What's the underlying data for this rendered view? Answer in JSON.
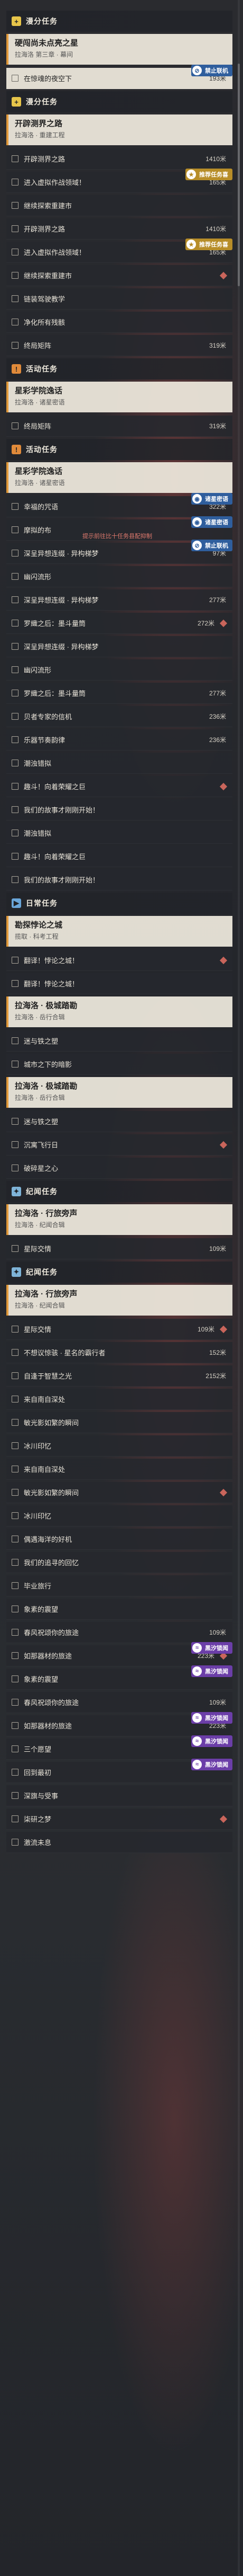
{
  "colors": {
    "side_task": "#e7c54a",
    "activity_task": "#e08a3a",
    "world_task": "#6aa6d9",
    "companion_task": "#7fb4d8",
    "accent_bar": "#e29a3b"
  },
  "rows": [
    {
      "kind": "header",
      "text": "漫分任务",
      "icon": "+",
      "color": "#e7c54a"
    },
    {
      "kind": "title",
      "title": "硬闯尚未点亮之星",
      "sub": "拉海洛 第三章 · 幕间",
      "icon": "quest-icon"
    },
    {
      "kind": "item",
      "text": "在惊魂的夜空下",
      "dist": "193米",
      "hl": true
    },
    {
      "kind": "header",
      "text": "漫分任务",
      "icon": "+",
      "color": "#e7c54a"
    },
    {
      "kind": "title",
      "title": "开辟测界之路",
      "sub": "拉海洛 · 重建工程",
      "icon": "quest-icon"
    },
    {
      "kind": "item",
      "text": "开辟测界之路",
      "dist": "1410米"
    },
    {
      "kind": "item",
      "text": "进入虚拟作战领域！",
      "dist": "165米"
    },
    {
      "kind": "item",
      "text": "继续探索重建市"
    },
    {
      "kind": "item",
      "text": "开辟测界之路",
      "dist": "1410米"
    },
    {
      "kind": "item",
      "text": "进入虚拟作战领域！",
      "dist": "165米"
    },
    {
      "kind": "item",
      "text": "继续探索重建市"
    },
    {
      "kind": "item",
      "text": "链装驾驶教学"
    },
    {
      "kind": "item",
      "text": "净化所有残骸"
    },
    {
      "kind": "item",
      "text": "终局矩阵",
      "dist": "319米"
    },
    {
      "kind": "header",
      "text": "活动任务",
      "icon": "!",
      "color": "#e08a3a"
    },
    {
      "kind": "title",
      "title": "星彩学院逸话",
      "sub": "拉海洛 · 诸星密语",
      "icon": "quest-icon"
    },
    {
      "kind": "item",
      "text": "终局矩阵",
      "dist": "319米"
    },
    {
      "kind": "header",
      "text": "活动任务",
      "icon": "!",
      "color": "#e08a3a"
    },
    {
      "kind": "title",
      "title": "星彩学院逸话",
      "sub": "拉海洛 · 诸星密语",
      "icon": "quest-icon"
    },
    {
      "kind": "item",
      "text": "幸福的咒语",
      "dist": "322米"
    },
    {
      "kind": "item",
      "text": "摩拟的布",
      "dist": ""
    },
    {
      "kind": "item",
      "text": "深呈异想连缀 · 异构梯梦",
      "dist": "97米"
    },
    {
      "kind": "item",
      "text": "幽闪流形"
    },
    {
      "kind": "item",
      "text": "深呈异想连缀 · 异构梯梦",
      "dist": "277米"
    },
    {
      "kind": "item",
      "text": "罗織之后：墨斗量筒",
      "dist": "272米"
    },
    {
      "kind": "item",
      "text": "深呈异想连缀 · 异构梯梦"
    },
    {
      "kind": "item",
      "text": "幽闪流形"
    },
    {
      "kind": "item",
      "text": "罗織之后：墨斗量筒",
      "dist": "277米"
    },
    {
      "kind": "item",
      "text": "贝者专家的信机",
      "dist": "236米"
    },
    {
      "kind": "item",
      "text": "乐器节奏韵律",
      "dist": "236米"
    },
    {
      "kind": "item",
      "text": "潮浊错拟"
    },
    {
      "kind": "item",
      "text": "趣斗！向着荣耀之巨"
    },
    {
      "kind": "item",
      "text": "我们的故事才刚刚开始！"
    },
    {
      "kind": "item",
      "text": "潮浊错拟"
    },
    {
      "kind": "item",
      "text": "趣斗！向着荣耀之巨"
    },
    {
      "kind": "item",
      "text": "我们的故事才刚刚开始！"
    },
    {
      "kind": "header",
      "text": "日常任务",
      "icon": "▶",
      "color": "#6aa6d9"
    },
    {
      "kind": "title",
      "title": "勘探悖论之城",
      "sub": "揽取 · 科考工程",
      "icon": "quest-icon"
    },
    {
      "kind": "item",
      "text": "翻译！悖论之城！"
    },
    {
      "kind": "item",
      "text": "翻译！悖论之城！"
    },
    {
      "kind": "title",
      "title": "拉海洛 · 极城踏勘",
      "sub": "拉海洛 · 岳行合辑",
      "icon": "quest-icon"
    },
    {
      "kind": "item",
      "text": "迷与铁之塑"
    },
    {
      "kind": "item",
      "text": "城市之下的暗影"
    },
    {
      "kind": "title",
      "title": "拉海洛 · 极城踏勘",
      "sub": "拉海洛 · 岳行合辑",
      "icon": "quest-icon"
    },
    {
      "kind": "item",
      "text": "迷与铁之塑"
    },
    {
      "kind": "item",
      "text": "沉寓飞行日"
    },
    {
      "kind": "item",
      "text": "破碎星之心"
    },
    {
      "kind": "header",
      "text": "纪闻任务",
      "icon": "✦",
      "color": "#7fb4d8"
    },
    {
      "kind": "title",
      "title": "拉海洛 · 行旅旁声",
      "sub": "拉海洛 · 纪闻合辑",
      "icon": "quest-icon"
    },
    {
      "kind": "item",
      "text": "星际交情",
      "dist": "109米"
    },
    {
      "kind": "header",
      "text": "纪闻任务",
      "icon": "✦",
      "color": "#7fb4d8"
    },
    {
      "kind": "title",
      "title": "拉海洛 · 行旅旁声",
      "sub": "拉海洛 · 纪闻合辑",
      "icon": "quest-icon"
    },
    {
      "kind": "item",
      "text": "星际交情",
      "dist": "109米"
    },
    {
      "kind": "item",
      "text": "不想议惊骇 · 星名的霸行者",
      "dist": "152米"
    },
    {
      "kind": "item",
      "text": "自逢于智慧之光",
      "dist": "2152米"
    },
    {
      "kind": "item",
      "text": "来自南自深处"
    },
    {
      "kind": "item",
      "text": "敏光影如繁的瞬间"
    },
    {
      "kind": "item",
      "text": "冰川印忆"
    },
    {
      "kind": "item",
      "text": "来自南自深处"
    },
    {
      "kind": "item",
      "text": "敏光影如繁的瞬间"
    },
    {
      "kind": "item",
      "text": "冰川印忆"
    },
    {
      "kind": "item",
      "text": "偶遇海洋的好机"
    },
    {
      "kind": "item",
      "text": "我们的追寻的回忆"
    },
    {
      "kind": "item",
      "text": "毕业旅行"
    },
    {
      "kind": "item",
      "text": "象素的震望"
    },
    {
      "kind": "item",
      "text": "春风祝颂你的旅途",
      "dist": "109米"
    },
    {
      "kind": "item",
      "text": "如那器材的旅途",
      "dist": "223米"
    },
    {
      "kind": "item",
      "text": "象素的震望"
    },
    {
      "kind": "item",
      "text": "春风祝颂你的旅途",
      "dist": "109米"
    },
    {
      "kind": "item",
      "text": "如那器材的旅途",
      "dist": "223米"
    },
    {
      "kind": "item",
      "text": "三个愿望"
    },
    {
      "kind": "item",
      "text": "回到最初"
    },
    {
      "kind": "item",
      "text": "深旗与受事"
    },
    {
      "kind": "item",
      "text": "柒研之梦"
    },
    {
      "kind": "item",
      "text": "激流未息"
    }
  ],
  "badges": [
    {
      "row": 2,
      "text": "禁止联机",
      "icon": "lock-icon",
      "style": "b-blue"
    },
    {
      "row": 6,
      "text": "推荐任务喜",
      "icon": "star-icon",
      "style": "b-yellow"
    },
    {
      "row": 9,
      "text": "推荐任务喜",
      "icon": "star-icon",
      "style": "b-yellow"
    },
    {
      "row": 19,
      "text": "诸星密语",
      "icon": "planet-icon",
      "style": "b-blue"
    },
    {
      "row": 20,
      "text": "诸星密语",
      "icon": "planet-icon",
      "style": "b-blue"
    },
    {
      "row": 21,
      "text": "禁止联机",
      "icon": "lock-icon",
      "style": "b-blue"
    },
    {
      "row": 66,
      "text": "黑汐锁闻",
      "icon": "wave-icon",
      "style": "b-purple"
    },
    {
      "row": 67,
      "text": "黑汐锁闻",
      "icon": "wave-icon",
      "style": "b-purple"
    },
    {
      "row": 69,
      "text": "黑汐锁闻",
      "icon": "wave-icon",
      "style": "b-purple"
    },
    {
      "row": 70,
      "text": "黑汐锁闻",
      "icon": "wave-icon",
      "style": "b-purple"
    },
    {
      "row": 71,
      "text": "黑汐锁闻",
      "icon": "wave-icon",
      "style": "b-purple"
    }
  ],
  "tip": {
    "row": 20,
    "text": "提示前往比十任务县配抑制"
  }
}
